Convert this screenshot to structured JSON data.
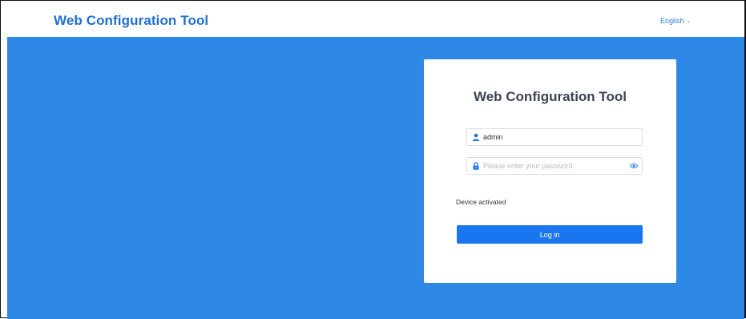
{
  "header": {
    "title": "Web Configuration Tool",
    "language": "English"
  },
  "login": {
    "title": "Web Configuration Tool",
    "username_value": "admin",
    "password_placeholder": "Please enter your password",
    "status": "Device activated",
    "login_label": "Log in"
  },
  "colors": {
    "brand": "#1f6fd1",
    "background": "#2e88e6",
    "button": "#1a75f0"
  },
  "icons": {
    "user": "user-icon",
    "lock": "lock-icon",
    "eye": "eye-icon",
    "chevron": "chevron-down-icon"
  }
}
